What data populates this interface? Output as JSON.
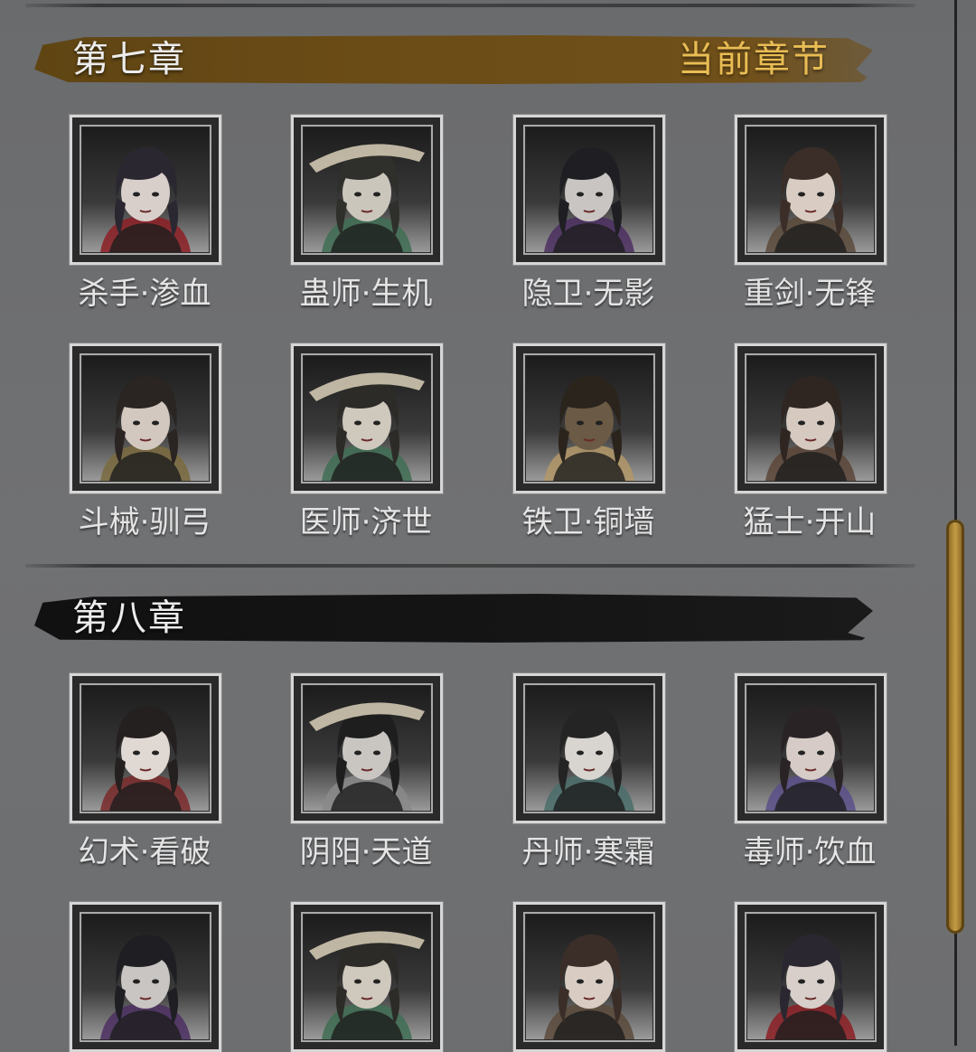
{
  "chapters": [
    {
      "title": "第七章",
      "status": "当前章节",
      "characters": [
        {
          "name": "杀手·渗血",
          "hair": "#2b2730",
          "skin": "#d8cfcb",
          "accent": "#8c1f25"
        },
        {
          "name": "蛊师·生机",
          "hair": "#2f2f2b",
          "skin": "#cbc6bc",
          "accent": "#3f6d54"
        },
        {
          "name": "隐卫·无影",
          "hair": "#1f1f23",
          "skin": "#c9c5c2",
          "accent": "#4b2f62"
        },
        {
          "name": "重剑·无锋",
          "hair": "#3b2e28",
          "skin": "#d9cdc3",
          "accent": "#5a4a3b"
        },
        {
          "name": "斗械·驯弓",
          "hair": "#2a2522",
          "skin": "#d2c8bf",
          "accent": "#7a6a3d"
        },
        {
          "name": "医师·济世",
          "hair": "#2d2b27",
          "skin": "#cfc8bd",
          "accent": "#3f6d54"
        },
        {
          "name": "铁卫·铜墙",
          "hair": "#2a241d",
          "skin": "#6b5a45",
          "accent": "#b39868"
        },
        {
          "name": "猛士·开山",
          "hair": "#2f2622",
          "skin": "#d6c9bf",
          "accent": "#5c4538"
        }
      ]
    },
    {
      "title": "第八章",
      "status": "",
      "characters": [
        {
          "name": "幻术·看破",
          "hair": "#24201f",
          "skin": "#e0d8d2",
          "accent": "#7a2a2a"
        },
        {
          "name": "阴阳·天道",
          "hair": "#1e1e1e",
          "skin": "#c9c6c2",
          "accent": "#8a8a8a"
        },
        {
          "name": "丹师·寒霜",
          "hair": "#242424",
          "skin": "#d8d4cf",
          "accent": "#4a6d6a"
        },
        {
          "name": "毒师·饮血",
          "hair": "#2a2325",
          "skin": "#d6cbc6",
          "accent": "#5a4f88"
        },
        {
          "name": "",
          "hair": "#1f1f23",
          "skin": "#c9c5c2",
          "accent": "#4b2f62"
        },
        {
          "name": "",
          "hair": "#2d2b27",
          "skin": "#cfc8bd",
          "accent": "#3f6d54"
        },
        {
          "name": "",
          "hair": "#3b2e28",
          "skin": "#d9cdc3",
          "accent": "#5a4a3b"
        },
        {
          "name": "",
          "hair": "#2b2730",
          "skin": "#d8cfcb",
          "accent": "#8c1f25"
        }
      ]
    }
  ],
  "colors": {
    "current_chapter_banner": "#6b4c17",
    "locked_chapter_banner": "#151515",
    "current_label": "#e9bd54",
    "scroll_thumb": "#c49b45"
  }
}
